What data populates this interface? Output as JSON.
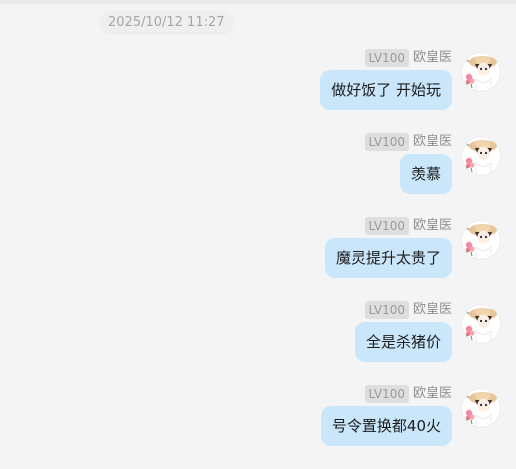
{
  "timestamp": "2025/10/12 11:27",
  "messages": [
    {
      "level": "LV100",
      "nickname": "欧皇医",
      "text": "做好饭了  开始玩"
    },
    {
      "level": "LV100",
      "nickname": "欧皇医",
      "text": "羡慕"
    },
    {
      "level": "LV100",
      "nickname": "欧皇医",
      "text": "魔灵提升太贵了"
    },
    {
      "level": "LV100",
      "nickname": "欧皇医",
      "text": "全是杀猪价"
    },
    {
      "level": "LV100",
      "nickname": "欧皇医",
      "text": "号令置换都40火"
    }
  ],
  "colors": {
    "background": "#f4f4f4",
    "bubble": "#c9e6fb",
    "badge": "#dedede"
  },
  "icons": {
    "avatar": "avatar-girl-straw-hat-icon"
  }
}
